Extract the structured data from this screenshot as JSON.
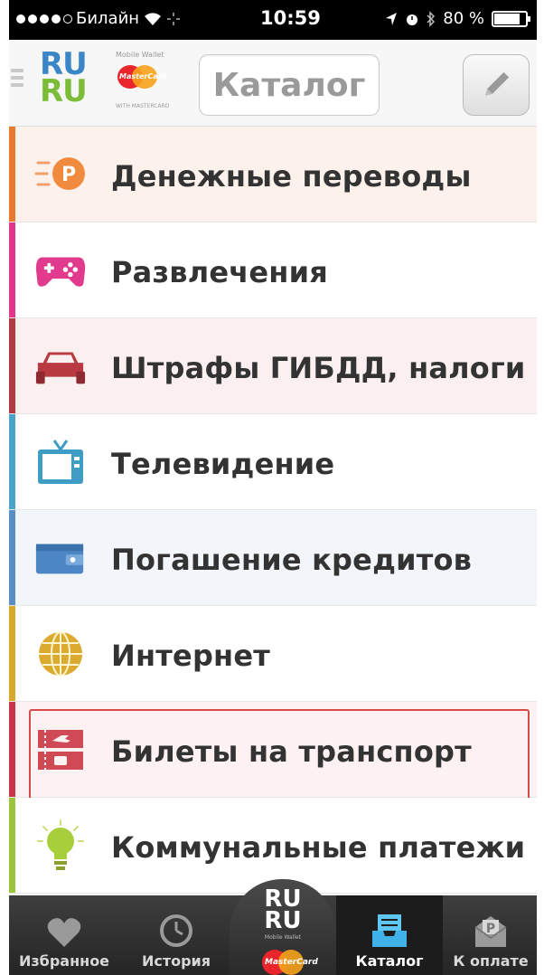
{
  "status_bar": {
    "carrier": "Билайн",
    "time": "10:59",
    "battery": "80 %"
  },
  "header": {
    "title": "Каталог",
    "logo_text_top": "RU",
    "logo_text_bottom": "RU",
    "mastercard_text": "MasterCard",
    "mobile_wallet_text": "Mobile Wallet",
    "with_mastercard_text": "WITH MASTERCARD"
  },
  "catalog": {
    "items": [
      {
        "label": "Денежные переводы",
        "icon": "money-transfer-icon",
        "color": "#e8792f",
        "bg": "#fdf1ec"
      },
      {
        "label": "Развлечения",
        "icon": "gamepad-icon",
        "color": "#e0368b",
        "bg": "#ffffff"
      },
      {
        "label": "Штрафы ГИБДД, налоги",
        "icon": "car-icon",
        "color": "#b03a3f",
        "bg": "#fbf0ef"
      },
      {
        "label": "Телевидение",
        "icon": "tv-icon",
        "color": "#4aa3c8",
        "bg": "#ffffff"
      },
      {
        "label": "Погашение кредитов",
        "icon": "wallet-icon",
        "color": "#5a8fc6",
        "bg": "#f2f5f9"
      },
      {
        "label": "Интернет",
        "icon": "globe-icon",
        "color": "#d9a92a",
        "bg": "#ffffff"
      },
      {
        "label": "Билеты на транспорт",
        "icon": "ticket-icon",
        "color": "#c8344a",
        "bg": "#fdf1f1"
      },
      {
        "label": "Коммунальные платежи",
        "icon": "lightbulb-icon",
        "color": "#9bc53d",
        "bg": "#ffffff"
      }
    ]
  },
  "tabbar": {
    "favorites": "Избранное",
    "history": "История",
    "center_top": "RU",
    "center_bottom": "RU",
    "catalog": "Каталог",
    "to_pay": "К оплате"
  }
}
